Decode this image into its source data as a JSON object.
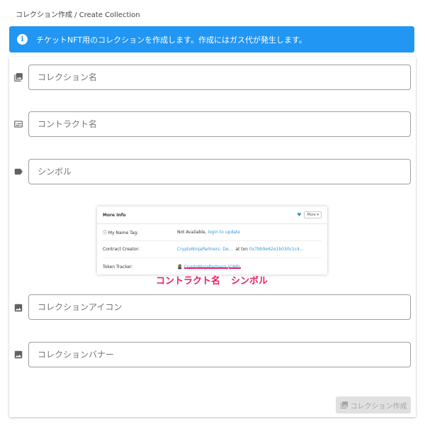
{
  "breadcrumb": "コレクション作成 / Create Collection",
  "alert": {
    "message": "チケットNFT用のコレクションを作成します。作成にはガス代が発生します。",
    "color": "#2196f3"
  },
  "fields": {
    "collection_name": {
      "placeholder": "コレクション名",
      "icon": "photo-library-icon"
    },
    "contract_name": {
      "placeholder": "コントラクト名",
      "icon": "subtitles-icon"
    },
    "symbol": {
      "placeholder": "シンボル",
      "icon": "label-icon"
    },
    "collection_icon": {
      "placeholder": "コレクションアイコン",
      "icon": "image-icon"
    },
    "collection_banner": {
      "placeholder": "コレクションバナー",
      "icon": "image-icon"
    }
  },
  "reference": {
    "title": "More Info",
    "more": "More",
    "rows": [
      {
        "label": "My Name Tag:",
        "value": "Not Available,",
        "link": "login to update"
      },
      {
        "label": "Contract Creator:",
        "value": "CryptoNinjaPartners: De…",
        "link2": "at txn",
        "tx": "0x7bb9e62e1b030c1c4…"
      },
      {
        "label": "Token Tracker:",
        "value": "CryptoNinjaPartners (CNP)"
      }
    ],
    "annotation_name": "コントラクト名",
    "annotation_symbol": "シンボル",
    "accent": "#e91e63"
  },
  "submit": {
    "label": "コレクション作成",
    "disabled": true
  }
}
